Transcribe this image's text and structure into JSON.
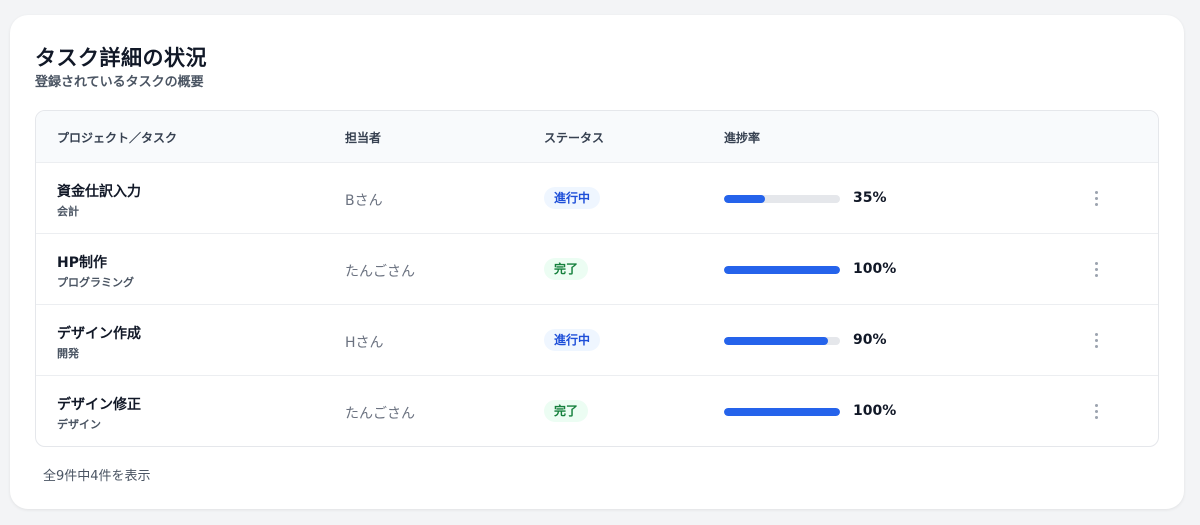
{
  "header": {
    "title": "タスク詳細の状況",
    "subtitle": "登録されているタスクの概要"
  },
  "table": {
    "columns": [
      "プロジェクト／タスク",
      "担当者",
      "ステータス",
      "進捗率"
    ],
    "rows": [
      {
        "name": "資金仕訳入力",
        "category": "会計",
        "assignee": "Bさん",
        "status": "進行中",
        "status_type": "progress",
        "progress": 35,
        "progress_label": "35%"
      },
      {
        "name": "HP制作",
        "category": "プログラミング",
        "assignee": "たんごさん",
        "status": "完了",
        "status_type": "done",
        "progress": 100,
        "progress_label": "100%"
      },
      {
        "name": "デザイン作成",
        "category": "開発",
        "assignee": "Hさん",
        "status": "進行中",
        "status_type": "progress",
        "progress": 90,
        "progress_label": "90%"
      },
      {
        "name": "デザイン修正",
        "category": "デザイン",
        "assignee": "たんごさん",
        "status": "完了",
        "status_type": "done",
        "progress": 100,
        "progress_label": "100%"
      }
    ],
    "row_menu_icon": "more-vertical-icon"
  },
  "footer": {
    "summary": "全9件中4件を表示"
  },
  "colors": {
    "accent": "#2563eb",
    "in_progress_badge_bg": "#eff6ff",
    "in_progress_badge_text": "#1d4ed8",
    "done_badge_bg": "#ecfdf3",
    "done_badge_text": "#15803d"
  }
}
